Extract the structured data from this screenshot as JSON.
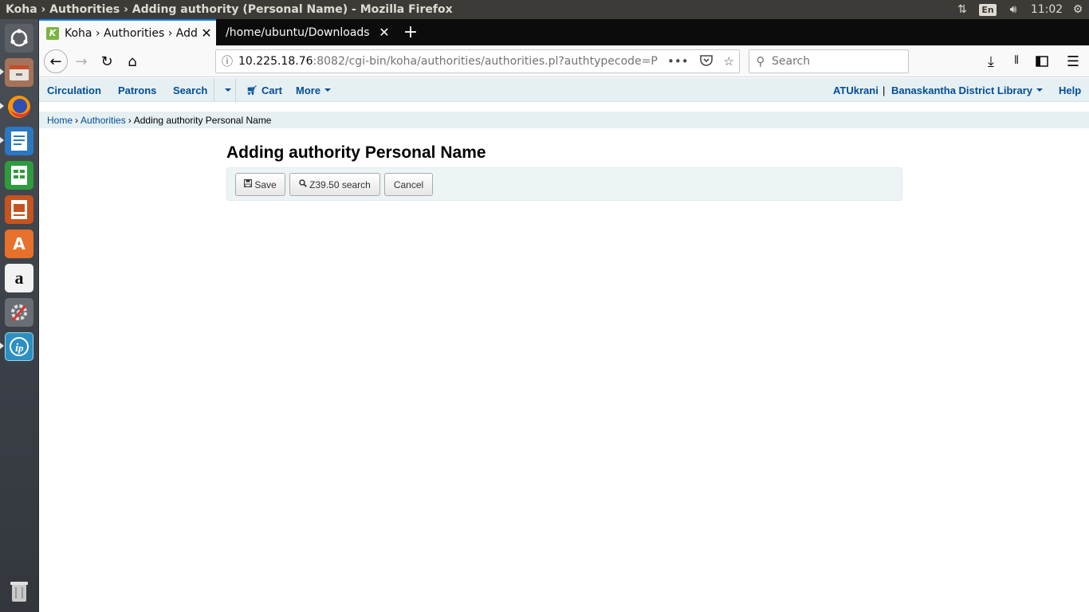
{
  "os": {
    "window_title": "Koha › Authorities › Adding authority (Personal Name) - Mozilla Firefox",
    "language": "En",
    "clock": "11:02",
    "launcher": [
      {
        "name": "ubuntu-dash"
      },
      {
        "name": "files"
      },
      {
        "name": "firefox"
      },
      {
        "name": "libreoffice-writer"
      },
      {
        "name": "libreoffice-calc"
      },
      {
        "name": "libreoffice-impress"
      },
      {
        "name": "ubuntu-software"
      },
      {
        "name": "amazon"
      },
      {
        "name": "system-settings"
      },
      {
        "name": "koha-app"
      },
      {
        "name": "trash"
      }
    ]
  },
  "browser": {
    "tabs": [
      {
        "label": "Koha › Authorities › Addi",
        "favicon": "K",
        "active": true
      },
      {
        "label": "/home/ubuntu/Downloads",
        "active": false
      }
    ],
    "url_host": "10.225.18.76",
    "url_rest": ":8082/cgi-bin/koha/authorities/authorities.pl?authtypecode=P",
    "search_placeholder": "Search"
  },
  "koha": {
    "nav_left": [
      "Circulation",
      "Patrons",
      "Search"
    ],
    "cart": "Cart",
    "more": "More",
    "user": "ATUkrani",
    "separator": "|",
    "library": "Banaskantha District Library",
    "help": "Help",
    "breadcrumb": {
      "home": "Home",
      "authorities": "Authorities",
      "current": "Adding authority Personal Name",
      "sep": "›"
    },
    "page_title": "Adding authority Personal Name",
    "buttons": {
      "save": "Save",
      "z3950": "Z39.50 search",
      "cancel": "Cancel"
    }
  },
  "colors": {
    "koha_link": "#004d99",
    "koha_nav_bg": "#e6f0f2",
    "firefox_accent": "#0a84ff"
  }
}
